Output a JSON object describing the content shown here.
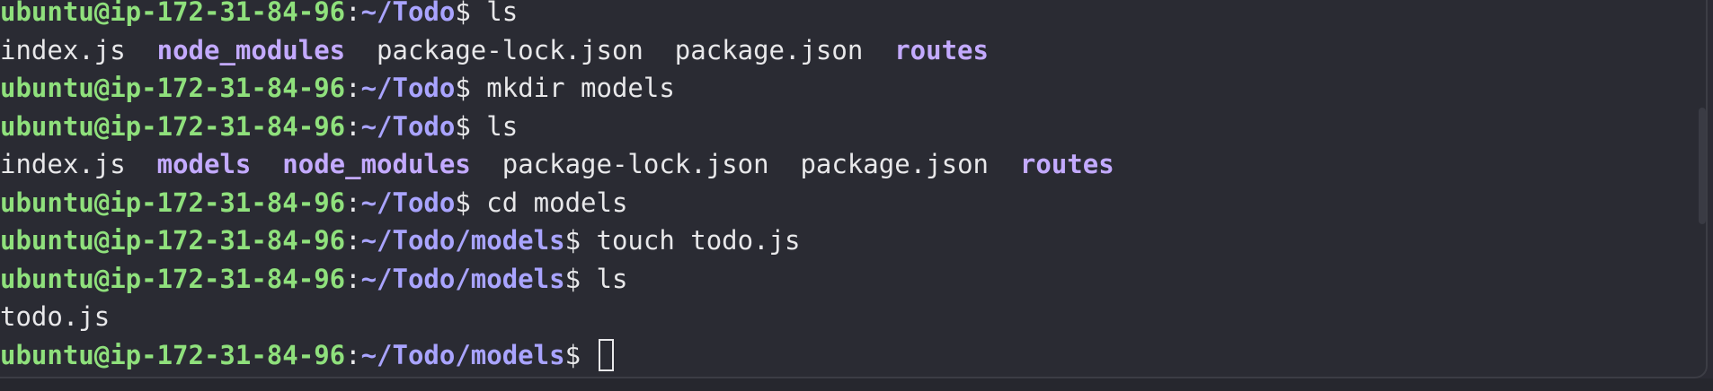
{
  "terminal": {
    "lines": [
      {
        "type": "prompt",
        "user": "ubuntu@ip-172-31-84-96",
        "colon": ":",
        "path": "~/Todo",
        "dollar": "$",
        "cmd": " ls"
      },
      {
        "type": "output",
        "items": [
          {
            "text": "index.js",
            "kind": "file"
          },
          {
            "text": "node_modules",
            "kind": "dir"
          },
          {
            "text": "package-lock.json",
            "kind": "file"
          },
          {
            "text": "package.json",
            "kind": "file"
          },
          {
            "text": "routes",
            "kind": "dir"
          }
        ]
      },
      {
        "type": "prompt",
        "user": "ubuntu@ip-172-31-84-96",
        "colon": ":",
        "path": "~/Todo",
        "dollar": "$",
        "cmd": " mkdir models"
      },
      {
        "type": "prompt",
        "user": "ubuntu@ip-172-31-84-96",
        "colon": ":",
        "path": "~/Todo",
        "dollar": "$",
        "cmd": " ls"
      },
      {
        "type": "output",
        "items": [
          {
            "text": "index.js",
            "kind": "file"
          },
          {
            "text": "models",
            "kind": "dir"
          },
          {
            "text": "node_modules",
            "kind": "dir"
          },
          {
            "text": "package-lock.json",
            "kind": "file"
          },
          {
            "text": "package.json",
            "kind": "file"
          },
          {
            "text": "routes",
            "kind": "dir"
          }
        ]
      },
      {
        "type": "prompt",
        "user": "ubuntu@ip-172-31-84-96",
        "colon": ":",
        "path": "~/Todo",
        "dollar": "$",
        "cmd": " cd models"
      },
      {
        "type": "prompt",
        "user": "ubuntu@ip-172-31-84-96",
        "colon": ":",
        "path": "~/Todo/models",
        "dollar": "$",
        "cmd": " touch todo.js"
      },
      {
        "type": "prompt",
        "user": "ubuntu@ip-172-31-84-96",
        "colon": ":",
        "path": "~/Todo/models",
        "dollar": "$",
        "cmd": " ls"
      },
      {
        "type": "output",
        "items": [
          {
            "text": "todo.js",
            "kind": "file"
          }
        ]
      },
      {
        "type": "prompt",
        "user": "ubuntu@ip-172-31-84-96",
        "colon": ":",
        "path": "~/Todo/models",
        "dollar": "$",
        "cmd": " ",
        "cursor": true
      }
    ]
  },
  "colors": {
    "background": "#2a2b33",
    "user_host": "#8fe07c",
    "path": "#a9a4ff",
    "directory": "#c3aaff",
    "text": "#e8e8ea"
  }
}
